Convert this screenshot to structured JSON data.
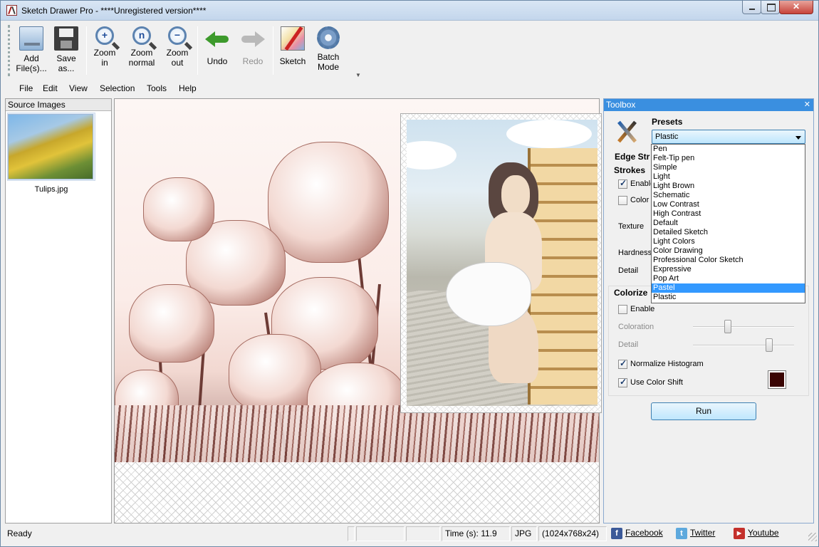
{
  "window": {
    "title": "Sketch Drawer Pro - ****Unregistered version****"
  },
  "toolbar": {
    "add_files": [
      "Add",
      "File(s)..."
    ],
    "save_as": [
      "Save",
      "as..."
    ],
    "zoom_in": [
      "Zoom",
      "in"
    ],
    "zoom_normal": [
      "Zoom",
      "normal"
    ],
    "zoom_out": [
      "Zoom",
      "out"
    ],
    "undo": "Undo",
    "redo": "Redo",
    "sketch": "Sketch",
    "batch_mode": [
      "Batch",
      "Mode"
    ]
  },
  "menu": [
    "File",
    "Edit",
    "View",
    "Selection",
    "Tools",
    "Help"
  ],
  "source_panel": {
    "header": "Source Images",
    "items": [
      {
        "name": "Tulips.jpg"
      }
    ]
  },
  "toolbox": {
    "title": "Toolbox",
    "presets_label": "Presets",
    "preset_value": "Plastic",
    "edge_strength_label": "Edge Str",
    "strokes_label": "Strokes",
    "enable_label": "Enable",
    "color_label": "Color s",
    "texture_label": "Texture",
    "hardness_label": "Hardness",
    "detail_label": "Detail",
    "colorize_label": "Colorize",
    "colorize_enable": "Enable",
    "coloration_label": "Coloration",
    "colorize_detail_label": "Detail",
    "coloration_level": 0.33,
    "colorize_detail_level": 0.77,
    "normalize_label": "Normalize Histogram",
    "color_shift_label": "Use Color Shift",
    "color_shift_color": "#3a0504",
    "run_label": "Run",
    "checks": {
      "strokes_enable": true,
      "color_s": false,
      "colorize_enable": false,
      "normalize": true,
      "color_shift": true
    }
  },
  "preset_options": [
    "Pen",
    "Felt-Tip pen",
    "Simple",
    "Light",
    "Light Brown",
    "Schematic",
    "Low Contrast",
    "High Contrast",
    "Default",
    "Detailed Sketch",
    "Light Colors",
    "Color Drawing",
    "Professional Color Sketch",
    "Expressive",
    "Pop Art",
    "Pastel",
    "Plastic"
  ],
  "preset_highlighted": "Pastel",
  "status": {
    "ready": "Ready",
    "time": "Time (s): 11.9",
    "format": "JPG",
    "dimensions": "(1024x768x24)",
    "facebook": "Facebook",
    "twitter": "Twitter",
    "youtube": "Youtube"
  },
  "colors": {
    "toolbox_title_bg": "#3a8fe0",
    "selection_highlight": "#3399ff"
  }
}
